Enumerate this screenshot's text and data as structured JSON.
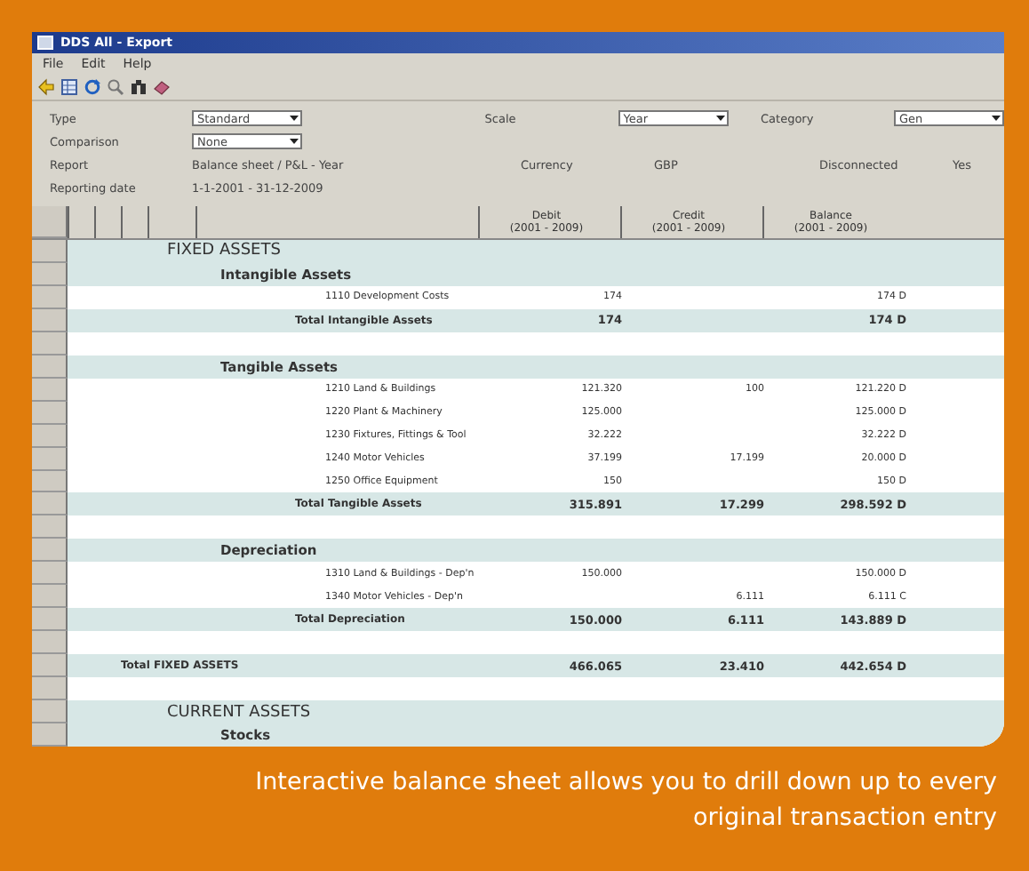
{
  "window": {
    "title": "DDS All - Export"
  },
  "menu": [
    "File",
    "Edit",
    "Help"
  ],
  "filter_rows": [
    [
      {
        "label": "Type",
        "value": "Standard",
        "kind": "dropdown"
      },
      {
        "label": "Scale",
        "value": "Year",
        "kind": "dropdown"
      },
      {
        "label": "Category",
        "value": "Gen",
        "kind": "dropdown"
      }
    ],
    [
      {
        "label": "Comparison",
        "value": "None",
        "kind": "dropdown"
      }
    ],
    [
      {
        "label": "Report",
        "value": "Balance sheet / P&L - Year",
        "kind": "text"
      },
      {
        "label": "Currency",
        "value": "GBP",
        "kind": "text"
      },
      {
        "label": "Disconnected",
        "value": "Yes",
        "kind": "text"
      }
    ],
    [
      {
        "label": "Reporting date",
        "value": "1-1-2001 - 31-12-2009",
        "kind": "text"
      }
    ]
  ],
  "table": {
    "columns": [
      {
        "title": "Debit",
        "period": "(2001 - 2009)"
      },
      {
        "title": "Credit",
        "period": "(2001 - 2009)"
      },
      {
        "title": "Balance",
        "period": "(2001 - 2009)"
      }
    ],
    "rows": [
      {
        "kind": "section",
        "label": "FIXED ASSETS"
      },
      {
        "kind": "group",
        "label": "Intangible Assets"
      },
      {
        "kind": "account",
        "label": "1110 Development Costs",
        "debit": "174",
        "balance": "174 D"
      },
      {
        "kind": "total",
        "label": "Total Intangible Assets",
        "debit": "174",
        "balance": "174 D"
      },
      {
        "kind": "blank"
      },
      {
        "kind": "group",
        "label": "Tangible Assets"
      },
      {
        "kind": "account",
        "label": "1210 Land & Buildings",
        "debit": "121.320",
        "credit": "100",
        "balance": "121.220 D"
      },
      {
        "kind": "account",
        "label": "1220 Plant & Machinery",
        "debit": "125.000",
        "balance": "125.000 D"
      },
      {
        "kind": "account",
        "label": "1230 Fixtures, Fittings & Tool",
        "debit": "32.222",
        "balance": "32.222 D"
      },
      {
        "kind": "account",
        "label": "1240 Motor Vehicles",
        "debit": "37.199",
        "credit": "17.199",
        "balance": "20.000 D"
      },
      {
        "kind": "account",
        "label": "1250 Office Equipment",
        "debit": "150",
        "balance": "150 D"
      },
      {
        "kind": "total",
        "label": "Total Tangible Assets",
        "debit": "315.891",
        "credit": "17.299",
        "balance": "298.592 D"
      },
      {
        "kind": "blank"
      },
      {
        "kind": "group",
        "label": "Depreciation"
      },
      {
        "kind": "account",
        "label": "1310 Land & Buildings - Dep'n",
        "debit": "150.000",
        "balance": "150.000 D"
      },
      {
        "kind": "account",
        "label": "1340 Motor Vehicles - Dep'n",
        "credit": "6.111",
        "balance": "6.111 C"
      },
      {
        "kind": "total",
        "label": "Total Depreciation",
        "debit": "150.000",
        "credit": "6.111",
        "balance": "143.889 D"
      },
      {
        "kind": "blank"
      },
      {
        "kind": "grand_total",
        "label": "Total FIXED ASSETS",
        "debit": "466.065",
        "credit": "23.410",
        "balance": "442.654 D"
      },
      {
        "kind": "blank"
      },
      {
        "kind": "section",
        "label": "CURRENT ASSETS"
      },
      {
        "kind": "group",
        "label": "Stocks"
      }
    ]
  },
  "caption": [
    "Interactive balance sheet allows you to drill down up to every",
    "original transaction entry"
  ]
}
